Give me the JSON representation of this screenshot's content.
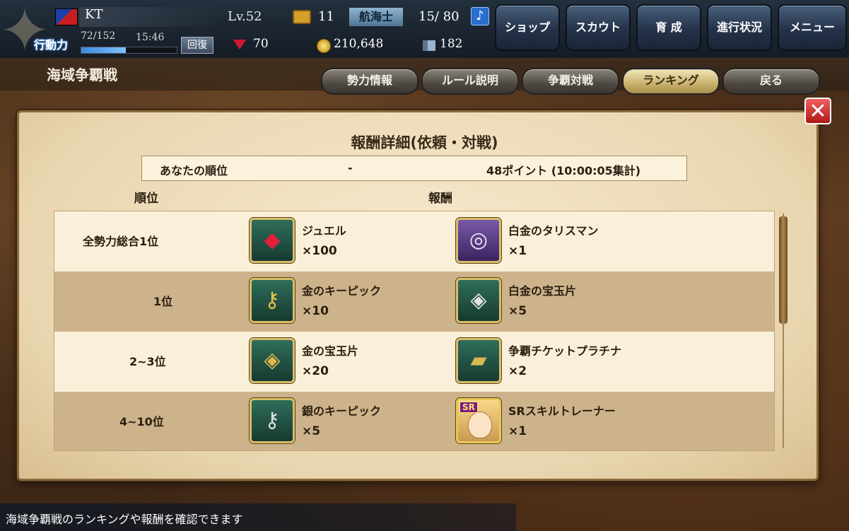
{
  "header": {
    "player_name": "KT",
    "level": "Lv.52",
    "chest_count": "11",
    "rank_badge": "航海士",
    "crew": "15/ 80",
    "music_icon": "♪",
    "action_label": "行動力",
    "action_points": "72/152",
    "action_time": "15:46",
    "action_fraction": 0.47,
    "recover_label": "回復",
    "jewels": "70",
    "coins": "210,648",
    "ships": "182"
  },
  "nav": {
    "shop": "ショップ",
    "scout": "スカウト",
    "train": "育 成",
    "progress": "進行状況",
    "menu": "メニュー"
  },
  "page": {
    "title": "海域争覇戦",
    "tabs": {
      "power": "勢力情報",
      "rules": "ルール説明",
      "battle": "争覇対戦",
      "ranking": "ランキング",
      "back": "戻る"
    }
  },
  "panel": {
    "close_glyph": "✕",
    "title": "報酬詳細(依頼・対戦)",
    "my_rank_label": "あなたの順位",
    "my_rank_value": "-",
    "my_points": "48ポイント (10:00:05集計)",
    "col_rank": "順位",
    "col_reward": "報酬"
  },
  "rewards": [
    {
      "rank": "全勢力総合1位",
      "item1": {
        "name": "ジュエル",
        "qty": "×100",
        "icon": "jewel-icon"
      },
      "item2": {
        "name": "白金のタリスマン",
        "qty": "×1",
        "icon": "ring-icon"
      }
    },
    {
      "rank": "1位",
      "item1": {
        "name": "金のキーピック",
        "qty": "×10",
        "icon": "keys-icon"
      },
      "item2": {
        "name": "白金の宝玉片",
        "qty": "×5",
        "icon": "gem-shard-icon"
      }
    },
    {
      "rank": "2~3位",
      "item1": {
        "name": "金の宝玉片",
        "qty": "×20",
        "icon": "gem-shard-icon"
      },
      "item2": {
        "name": "争覇チケットプラチナ",
        "qty": "×2",
        "icon": "ticket-icon"
      }
    },
    {
      "rank": "4~10位",
      "item1": {
        "name": "銀のキーピック",
        "qty": "×5",
        "icon": "keys-icon"
      },
      "item2": {
        "name": "SRスキルトレーナー",
        "qty": "×1",
        "icon": "trainer-portrait",
        "tag": "SR"
      }
    }
  ],
  "footer": {
    "hint": "海域争覇戦のランキングや報酬を確認できます"
  }
}
